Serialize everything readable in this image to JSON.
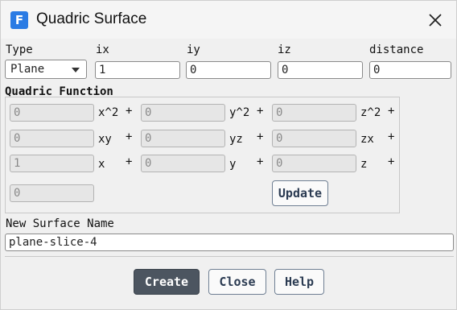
{
  "window": {
    "title": "Quadric Surface",
    "app_icon": "F"
  },
  "header": {
    "type_label": "Type",
    "type_value": "Plane",
    "ix_label": "ix",
    "ix_value": "1",
    "iy_label": "iy",
    "iy_value": "0",
    "iz_label": "iz",
    "iz_value": "0",
    "distance_label": "distance",
    "distance_value": "0"
  },
  "quadric": {
    "title": "Quadric Function",
    "rows": [
      {
        "fields": [
          "0",
          "0",
          "0"
        ],
        "terms": [
          "x^2",
          "y^2",
          "z^2"
        ],
        "plus": [
          "+",
          "+",
          "+"
        ]
      },
      {
        "fields": [
          "0",
          "0",
          "0"
        ],
        "terms": [
          "xy",
          "yz",
          "zx"
        ],
        "plus": [
          "+",
          "+",
          "+"
        ]
      },
      {
        "fields": [
          "1",
          "0",
          "0"
        ],
        "terms": [
          "x",
          "y",
          "z"
        ],
        "plus": [
          "+",
          "+",
          "+"
        ]
      }
    ],
    "constant": "0",
    "update_label": "Update"
  },
  "surface_name": {
    "label": "New Surface Name",
    "value": "plane-slice-4"
  },
  "footer": {
    "create": "Create",
    "close": "Close",
    "help": "Help"
  }
}
